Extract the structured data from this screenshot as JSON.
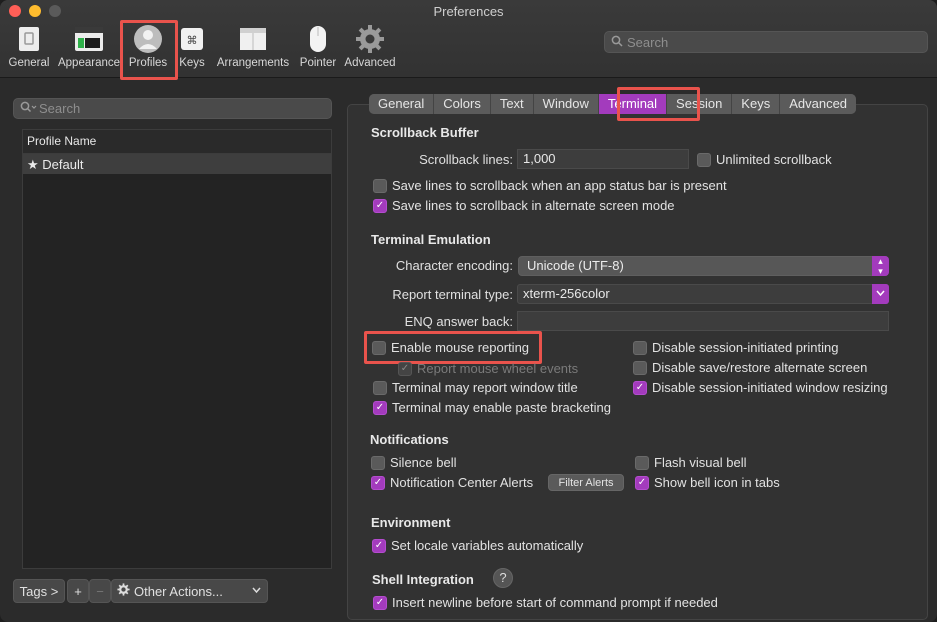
{
  "window": {
    "title": "Preferences"
  },
  "toolbar": {
    "items": [
      {
        "label": "General"
      },
      {
        "label": "Appearance"
      },
      {
        "label": "Profiles"
      },
      {
        "label": "Keys"
      },
      {
        "label": "Arrangements"
      },
      {
        "label": "Pointer"
      },
      {
        "label": "Advanced"
      }
    ],
    "search_placeholder": "Search"
  },
  "sidebar": {
    "search_placeholder": "Search",
    "column_header": "Profile Name",
    "profiles": [
      {
        "name": "Default",
        "star": "★"
      }
    ],
    "tags_label": "Tags >",
    "add_label": "+",
    "remove_label": "−",
    "other_actions_label": "Other Actions..."
  },
  "tabs": [
    {
      "label": "General"
    },
    {
      "label": "Colors"
    },
    {
      "label": "Text"
    },
    {
      "label": "Window"
    },
    {
      "label": "Terminal",
      "active": true
    },
    {
      "label": "Session"
    },
    {
      "label": "Keys"
    },
    {
      "label": "Advanced"
    }
  ],
  "scrollback": {
    "title": "Scrollback Buffer",
    "lines_label": "Scrollback lines:",
    "lines_value": "1,000",
    "unlimited_label": "Unlimited scrollback",
    "save_status_bar_label": "Save lines to scrollback when an app status bar is present",
    "save_alt_screen_label": "Save lines to scrollback in alternate screen mode"
  },
  "emulation": {
    "title": "Terminal Emulation",
    "encoding_label": "Character encoding:",
    "encoding_value": "Unicode (UTF-8)",
    "report_type_label": "Report terminal type:",
    "report_type_value": "xterm-256color",
    "enq_label": "ENQ answer back:",
    "enq_value": "",
    "mouse_reporting_label": "Enable mouse reporting",
    "wheel_events_label": "Report mouse wheel events",
    "window_title_label": "Terminal may report window title",
    "paste_bracketing_label": "Terminal may enable paste bracketing",
    "disable_printing_label": "Disable session-initiated printing",
    "disable_alt_screen_label": "Disable save/restore alternate screen",
    "disable_resizing_label": "Disable session-initiated window resizing"
  },
  "notifications": {
    "title": "Notifications",
    "silence_bell_label": "Silence bell",
    "flash_bell_label": "Flash visual bell",
    "nc_alerts_label": "Notification Center Alerts",
    "filter_alerts_label": "Filter Alerts",
    "bell_icon_label": "Show bell icon in tabs"
  },
  "environment": {
    "title": "Environment",
    "locale_label": "Set locale variables automatically"
  },
  "shell": {
    "title": "Shell Integration",
    "help_label": "?",
    "newline_label": "Insert newline before start of command prompt if needed"
  },
  "check_mark": "✓",
  "colors": {
    "accent": "#a33bbd",
    "highlight": "#e9534c"
  }
}
